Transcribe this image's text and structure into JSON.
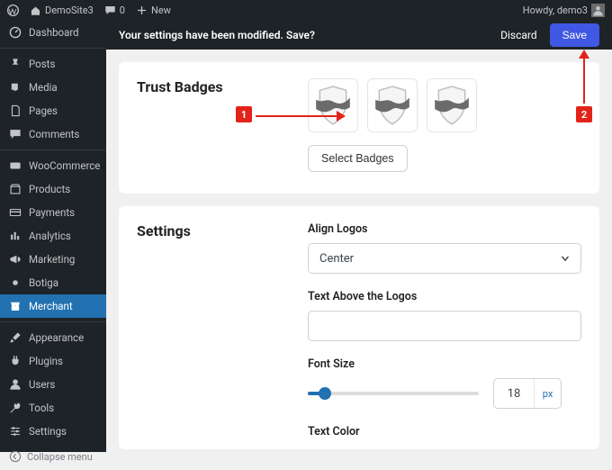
{
  "adminbar": {
    "site_name": "DemoSite3",
    "comment_count": "0",
    "new_label": "New",
    "howdy": "Howdy, demo3"
  },
  "sidebar": {
    "items": [
      {
        "id": "dashboard",
        "label": "Dashboard",
        "icon": "dashboard"
      },
      {
        "id": "posts",
        "label": "Posts",
        "icon": "pin"
      },
      {
        "id": "media",
        "label": "Media",
        "icon": "media"
      },
      {
        "id": "pages",
        "label": "Pages",
        "icon": "page"
      },
      {
        "id": "comments",
        "label": "Comments",
        "icon": "comment"
      },
      {
        "id": "woocommerce",
        "label": "WooCommerce",
        "icon": "woo"
      },
      {
        "id": "products",
        "label": "Products",
        "icon": "product"
      },
      {
        "id": "payments",
        "label": "Payments",
        "icon": "card"
      },
      {
        "id": "analytics",
        "label": "Analytics",
        "icon": "analytics"
      },
      {
        "id": "marketing",
        "label": "Marketing",
        "icon": "megaphone"
      },
      {
        "id": "botiga",
        "label": "Botiga",
        "icon": "dot"
      },
      {
        "id": "merchant",
        "label": "Merchant",
        "icon": "merchant",
        "current": true
      },
      {
        "id": "appearance",
        "label": "Appearance",
        "icon": "brush"
      },
      {
        "id": "plugins",
        "label": "Plugins",
        "icon": "plug"
      },
      {
        "id": "users",
        "label": "Users",
        "icon": "user"
      },
      {
        "id": "tools",
        "label": "Tools",
        "icon": "wrench"
      },
      {
        "id": "settings",
        "label": "Settings",
        "icon": "sliders"
      }
    ],
    "collapse_label": "Collapse menu"
  },
  "savebar": {
    "message": "Your settings have been modified. Save?",
    "discard": "Discard",
    "save": "Save"
  },
  "trust_badges": {
    "title": "Trust Badges",
    "select_button": "Select Badges"
  },
  "settings": {
    "title": "Settings",
    "align_label": "Align Logos",
    "align_value": "Center",
    "text_above_label": "Text Above the Logos",
    "text_above_value": "",
    "font_size_label": "Font Size",
    "font_size_value": "18",
    "font_size_unit": "px",
    "text_color_label": "Text Color"
  },
  "annotations": {
    "marker1": "1",
    "marker2": "2"
  }
}
